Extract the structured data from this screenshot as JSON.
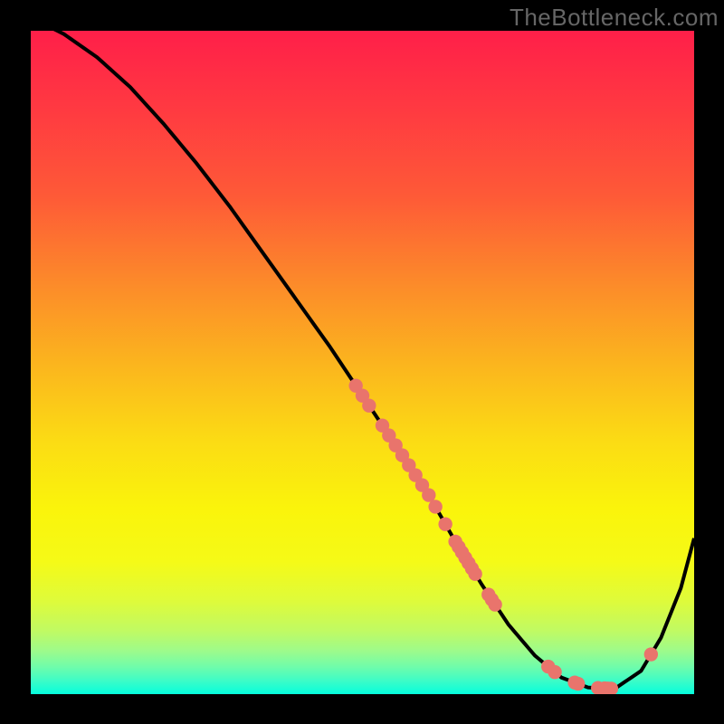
{
  "watermark": "TheBottleneck.com",
  "colors": {
    "bg_black": "#000000",
    "line": "#000000",
    "dot": "#E9746C",
    "text": "#666666"
  },
  "gradient_stops": [
    {
      "offset": 0.0,
      "color": "#FF1F49"
    },
    {
      "offset": 0.12,
      "color": "#FF3A41"
    },
    {
      "offset": 0.25,
      "color": "#FE5A37"
    },
    {
      "offset": 0.38,
      "color": "#FC8A2A"
    },
    {
      "offset": 0.5,
      "color": "#FBB41E"
    },
    {
      "offset": 0.62,
      "color": "#FBDC14"
    },
    {
      "offset": 0.72,
      "color": "#FAF40B"
    },
    {
      "offset": 0.8,
      "color": "#F5FA17"
    },
    {
      "offset": 0.86,
      "color": "#DEFB3B"
    },
    {
      "offset": 0.905,
      "color": "#C0FA63"
    },
    {
      "offset": 0.935,
      "color": "#9DFB8B"
    },
    {
      "offset": 0.96,
      "color": "#6DFCAC"
    },
    {
      "offset": 0.98,
      "color": "#3CFCC7"
    },
    {
      "offset": 1.0,
      "color": "#05FEDD"
    }
  ],
  "chart_data": {
    "type": "line",
    "title": "",
    "xlabel": "",
    "ylabel": "",
    "xlim": [
      0,
      1
    ],
    "ylim": [
      0,
      1
    ],
    "series": [
      {
        "name": "curve",
        "x": [
          0.0,
          0.02,
          0.05,
          0.1,
          0.15,
          0.2,
          0.25,
          0.3,
          0.35,
          0.4,
          0.45,
          0.5,
          0.55,
          0.6,
          0.64,
          0.68,
          0.72,
          0.76,
          0.8,
          0.84,
          0.88,
          0.92,
          0.95,
          0.98,
          1.0
        ],
        "y": [
          1.02,
          1.01,
          0.995,
          0.96,
          0.915,
          0.86,
          0.8,
          0.735,
          0.665,
          0.595,
          0.525,
          0.45,
          0.375,
          0.3,
          0.23,
          0.165,
          0.105,
          0.058,
          0.025,
          0.01,
          0.008,
          0.035,
          0.085,
          0.16,
          0.235
        ]
      }
    ],
    "dots_on_curve_x": [
      0.49,
      0.5,
      0.51,
      0.53,
      0.54,
      0.55,
      0.56,
      0.57,
      0.58,
      0.59,
      0.6,
      0.61,
      0.625,
      0.64,
      0.645,
      0.65,
      0.655,
      0.66,
      0.665,
      0.67,
      0.69,
      0.695,
      0.7,
      0.78,
      0.79,
      0.82,
      0.825,
      0.855,
      0.865,
      0.87,
      0.875,
      0.935
    ]
  }
}
